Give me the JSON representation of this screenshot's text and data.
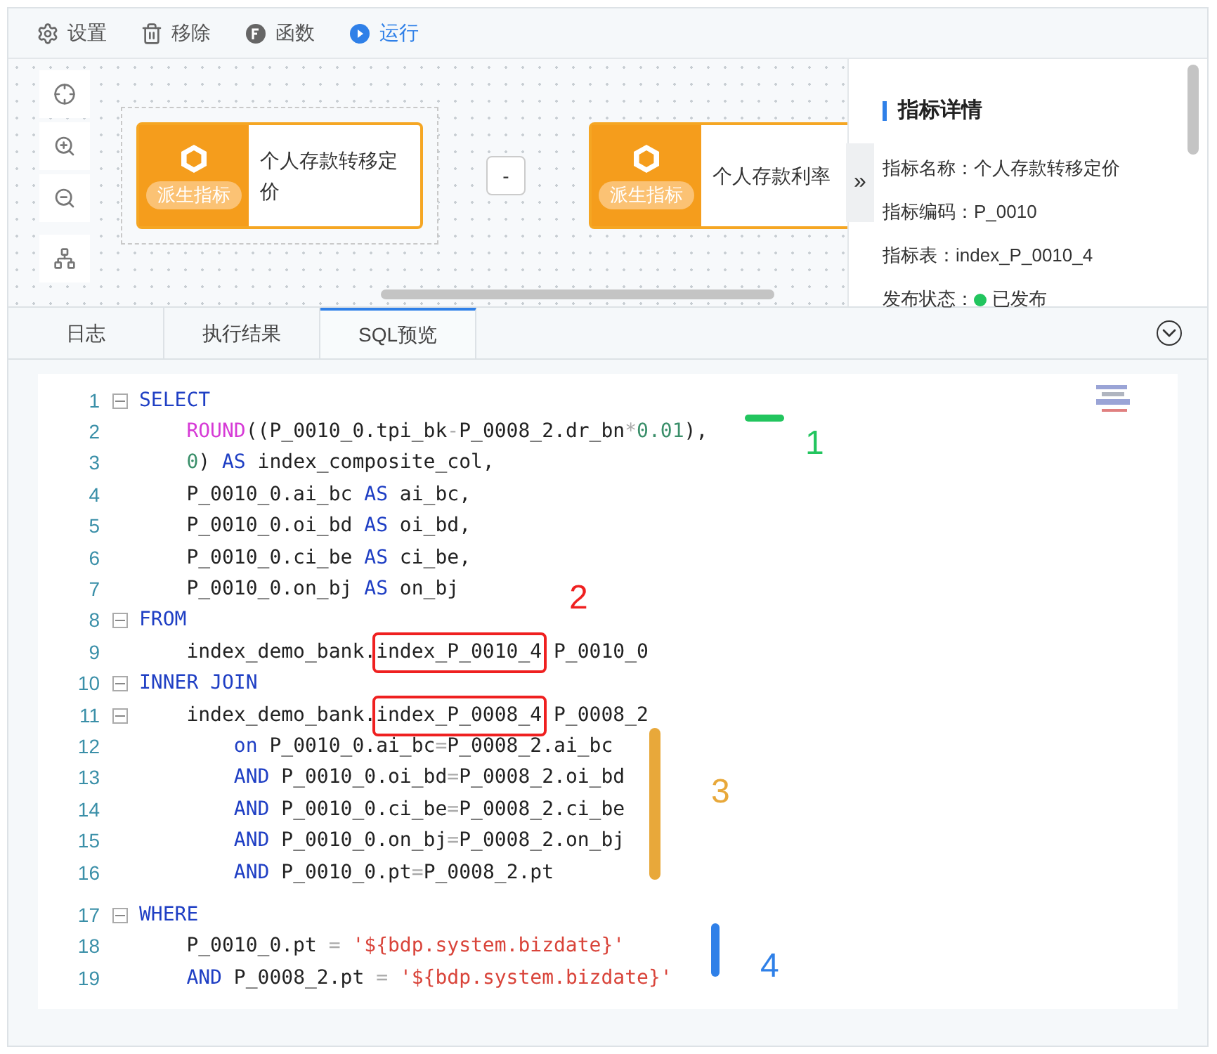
{
  "toolbar": [
    {
      "label": "设置",
      "highlighted": false
    },
    {
      "label": "移除",
      "highlighted": false
    },
    {
      "label": "函数",
      "highlighted": false
    },
    {
      "label": "运行",
      "highlighted": true
    }
  ],
  "canvas": {
    "nodes": [
      {
        "badge": "派生指标",
        "name": "个人存款转移定价",
        "selected": true
      },
      {
        "badge": "派生指标",
        "name": "个人存款利率",
        "selected": false
      }
    ],
    "operator": "-"
  },
  "collapse_button": "»",
  "detail_panel": {
    "title": "指标详情",
    "fields": [
      {
        "label": "指标名称：",
        "value": "个人存款转移定价"
      },
      {
        "label": "指标编码：",
        "value": "P_0010"
      },
      {
        "label": "指标表：",
        "value": "index_P_0010_4"
      },
      {
        "label": "发布状态：",
        "value": "已发布",
        "color": "#22c55e"
      }
    ]
  },
  "tabs": [
    {
      "label": "日志",
      "selected": false
    },
    {
      "label": "执行结果",
      "selected": false
    },
    {
      "label": "SQL预览",
      "selected": true
    }
  ],
  "code": [
    {
      "number": "1",
      "expanded": true,
      "tokens": [
        {
          "kind": "kw",
          "text": "SELECT"
        }
      ],
      "children": [
        {
          "number": "2",
          "tokens": [
            {
              "kind": "fn",
              "text": "ROUND"
            },
            {
              "kind": "plain",
              "text": "((P_0010_0.tpi_bk"
            },
            {
              "kind": "op",
              "text": "-"
            },
            {
              "kind": "plain",
              "text": "P_0008_2.dr_bn"
            },
            {
              "kind": "op",
              "text": "*"
            },
            {
              "kind": "num",
              "text": "0.01"
            },
            {
              "kind": "plain",
              "text": "),"
            }
          ]
        },
        {
          "number": "3",
          "tokens": [
            {
              "kind": "num",
              "text": "0"
            },
            {
              "kind": "plain",
              "text": ") "
            },
            {
              "kind": "kw",
              "text": "AS"
            },
            {
              "kind": "plain",
              "text": " index_composite_col,"
            }
          ]
        },
        {
          "number": "4",
          "tokens": [
            {
              "kind": "plain",
              "text": "P_0010_0.ai_bc "
            },
            {
              "kind": "kw",
              "text": "AS"
            },
            {
              "kind": "plain",
              "text": " ai_bc,"
            }
          ]
        },
        {
          "number": "5",
          "tokens": [
            {
              "kind": "plain",
              "text": "P_0010_0.oi_bd "
            },
            {
              "kind": "kw",
              "text": "AS"
            },
            {
              "kind": "plain",
              "text": " oi_bd,"
            }
          ]
        },
        {
          "number": "6",
          "tokens": [
            {
              "kind": "plain",
              "text": "P_0010_0.ci_be "
            },
            {
              "kind": "kw",
              "text": "AS"
            },
            {
              "kind": "plain",
              "text": " ci_be,"
            }
          ]
        },
        {
          "number": "7",
          "tokens": [
            {
              "kind": "plain",
              "text": "P_0010_0.on_bj "
            },
            {
              "kind": "kw",
              "text": "AS"
            },
            {
              "kind": "plain",
              "text": " on_bj"
            }
          ]
        }
      ]
    },
    {
      "number": "8",
      "expanded": true,
      "tokens": [
        {
          "kind": "kw",
          "text": "FROM"
        }
      ],
      "children": [
        {
          "number": "9",
          "tokens": [
            {
              "kind": "plain",
              "text": "index_demo_bank."
            },
            {
              "kind": "plain",
              "text": "index_P_0010_4",
              "boxed": true
            },
            {
              "kind": "plain",
              "text": " P_0010_0"
            }
          ]
        }
      ]
    },
    {
      "number": "10",
      "expanded": true,
      "tokens": [
        {
          "kind": "kw",
          "text": "INNER JOIN"
        }
      ],
      "children": [
        {
          "number": "11",
          "expanded": true,
          "tokens": [
            {
              "kind": "plain",
              "text": "index_demo_bank."
            },
            {
              "kind": "plain",
              "text": "index_P_0008_4",
              "boxed": true
            },
            {
              "kind": "plain",
              "text": " P_0008_2"
            }
          ],
          "children": [
            {
              "number": "12",
              "tokens": [
                {
                  "kind": "kw",
                  "text": "on"
                },
                {
                  "kind": "plain",
                  "text": " P_0010_0.ai_bc"
                },
                {
                  "kind": "op",
                  "text": "="
                },
                {
                  "kind": "plain",
                  "text": "P_0008_2.ai_bc"
                }
              ]
            },
            {
              "number": "13",
              "tokens": [
                {
                  "kind": "kw",
                  "text": "AND"
                },
                {
                  "kind": "plain",
                  "text": " P_0010_0.oi_bd"
                },
                {
                  "kind": "op",
                  "text": "="
                },
                {
                  "kind": "plain",
                  "text": "P_0008_2.oi_bd"
                }
              ]
            },
            {
              "number": "14",
              "tokens": [
                {
                  "kind": "kw",
                  "text": "AND"
                },
                {
                  "kind": "plain",
                  "text": " P_0010_0.ci_be"
                },
                {
                  "kind": "op",
                  "text": "="
                },
                {
                  "kind": "plain",
                  "text": "P_0008_2.ci_be"
                }
              ]
            },
            {
              "number": "15",
              "tokens": [
                {
                  "kind": "kw",
                  "text": "AND"
                },
                {
                  "kind": "plain",
                  "text": " P_0010_0.on_bj"
                },
                {
                  "kind": "op",
                  "text": "="
                },
                {
                  "kind": "plain",
                  "text": "P_0008_2.on_bj"
                }
              ]
            },
            {
              "number": "16",
              "tokens": [
                {
                  "kind": "kw",
                  "text": "AND"
                },
                {
                  "kind": "plain",
                  "text": " P_0010_0.pt"
                },
                {
                  "kind": "op",
                  "text": "="
                },
                {
                  "kind": "plain",
                  "text": "P_0008_2.pt"
                }
              ]
            }
          ]
        }
      ]
    },
    {
      "number": "17",
      "expanded": true,
      "tokens": [
        {
          "kind": "kw",
          "text": "WHERE"
        }
      ],
      "children": [
        {
          "number": "18",
          "tokens": [
            {
              "kind": "plain",
              "text": "P_0010_0.pt "
            },
            {
              "kind": "op",
              "text": "= "
            },
            {
              "kind": "str",
              "text": "'${bdp.system.bizdate}'"
            }
          ]
        },
        {
          "number": "19",
          "tokens": [
            {
              "kind": "kw",
              "text": "AND"
            },
            {
              "kind": "plain",
              "text": " P_0008_2.pt "
            },
            {
              "kind": "op",
              "text": "= "
            },
            {
              "kind": "str",
              "text": "'${bdp.system.bizdate}'"
            }
          ]
        }
      ]
    }
  ],
  "annotations": [
    {
      "kind": "dash",
      "label": "1",
      "color": "#22c55e"
    },
    {
      "kind": "boxes",
      "label": "2",
      "color": "#ef2020"
    },
    {
      "kind": "bar",
      "label": "3",
      "color": "#e8a83a"
    },
    {
      "kind": "bar",
      "label": "4",
      "color": "#2f80e8"
    }
  ]
}
